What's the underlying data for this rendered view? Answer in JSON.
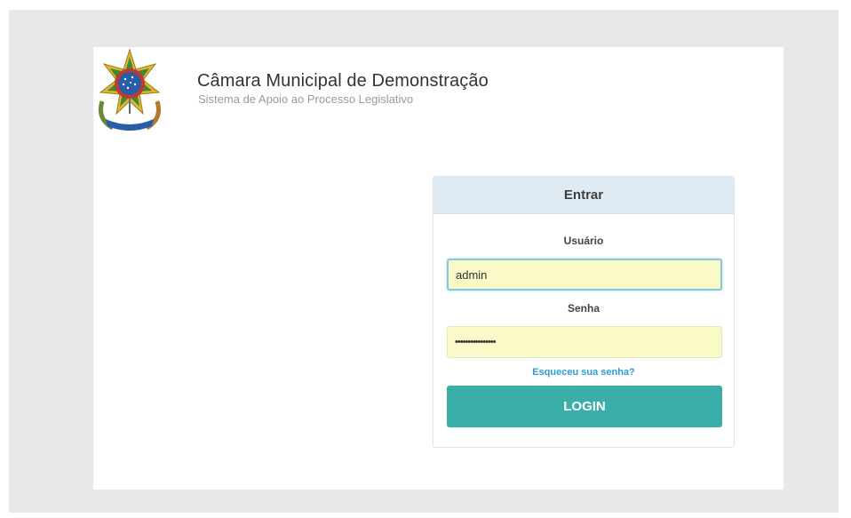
{
  "header": {
    "title": "Câmara Municipal de Demonstração",
    "subtitle": "Sistema de Apoio ao Processo Legislativo",
    "emblem_icon": "brazil-coat-of-arms"
  },
  "login": {
    "heading": "Entrar",
    "username_label": "Usuário",
    "username_value": "admin",
    "password_label": "Senha",
    "password_value": "••••••••••••••••",
    "forgot_link": "Esqueceu sua senha?",
    "submit_label": "LOGIN"
  },
  "colors": {
    "panel_heading_bg": "#dfeaf3",
    "input_bg": "#fafac8",
    "button_bg": "#3aafa9",
    "link": "#2a9fd6"
  }
}
